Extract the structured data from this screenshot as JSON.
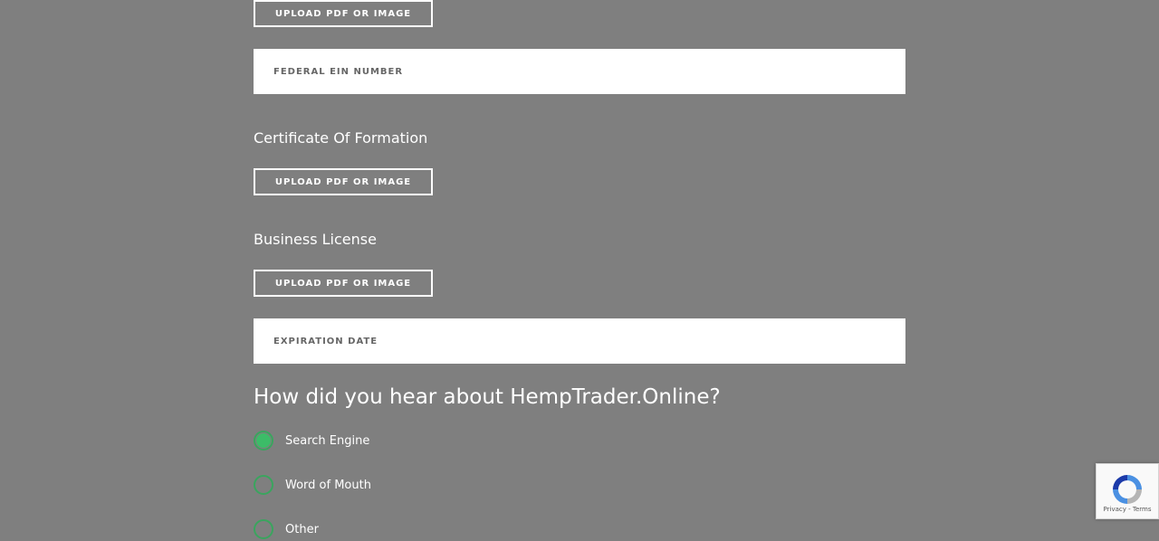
{
  "uploads": {
    "top_label": "UPLOAD PDF OR IMAGE",
    "certificate_label": "UPLOAD PDF OR IMAGE",
    "license_label": "UPLOAD PDF OR IMAGE"
  },
  "fields": {
    "ein_placeholder": "FEDERAL EIN NUMBER",
    "expiration_placeholder": "EXPIRATION DATE"
  },
  "sections": {
    "certificate_title": "Certificate Of Formation",
    "license_title": "Business License"
  },
  "referral": {
    "question": "How did you hear about HempTrader.Online?",
    "options": [
      {
        "label": "Search Engine",
        "checked": true
      },
      {
        "label": "Word of Mouth",
        "checked": false
      },
      {
        "label": "Other",
        "checked": false
      }
    ]
  },
  "recaptcha": {
    "links": "Privacy - Terms"
  },
  "colors": {
    "background": "#7f7f7f",
    "radio_accent": "#3cbc68"
  }
}
